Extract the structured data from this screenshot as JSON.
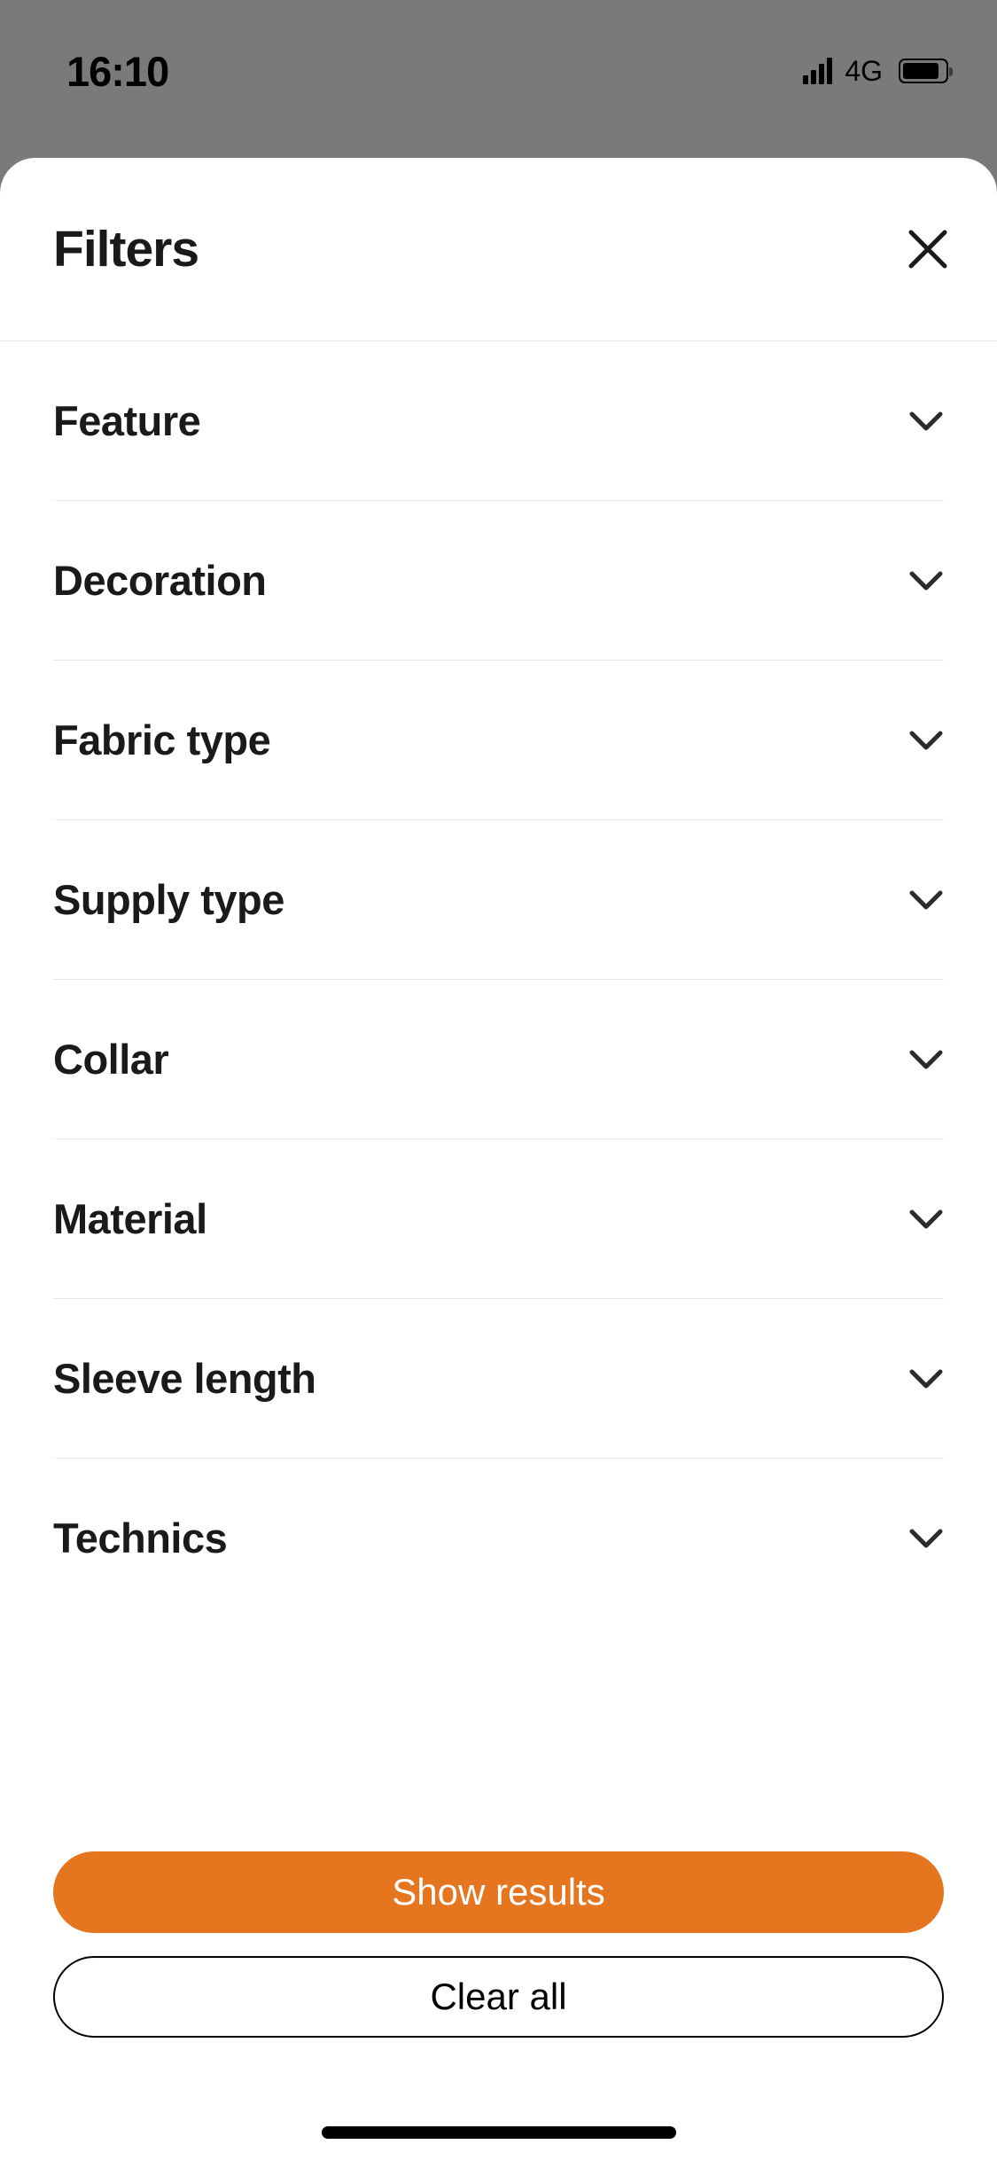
{
  "statusBar": {
    "time": "16:10",
    "networkType": "4G"
  },
  "sheet": {
    "title": "Filters"
  },
  "filters": [
    {
      "label": "Feature"
    },
    {
      "label": "Decoration"
    },
    {
      "label": "Fabric type"
    },
    {
      "label": "Supply type"
    },
    {
      "label": "Collar"
    },
    {
      "label": "Material"
    },
    {
      "label": "Sleeve length"
    },
    {
      "label": "Technics"
    }
  ],
  "buttons": {
    "primary": "Show results",
    "secondary": "Clear all"
  }
}
